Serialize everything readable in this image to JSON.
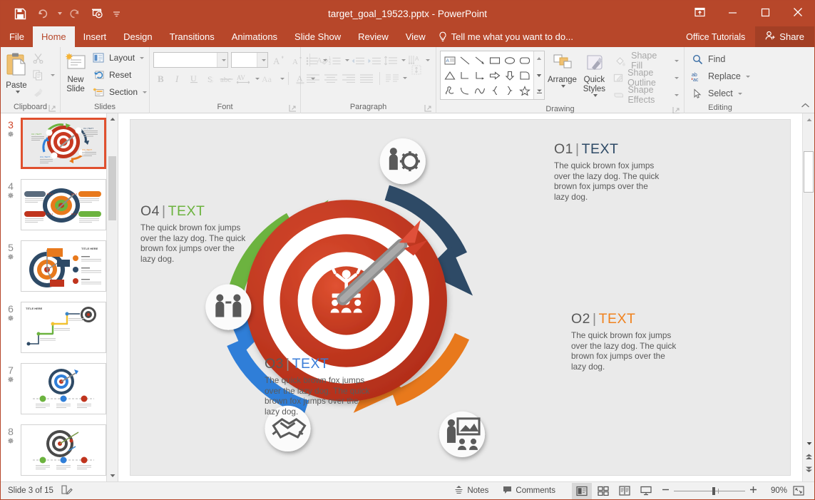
{
  "window": {
    "title": "target_goal_19523.pptx - PowerPoint",
    "accent": "#b7472a",
    "qat": [
      {
        "name": "save-icon",
        "label": "Save"
      },
      {
        "name": "undo-icon",
        "label": "Undo"
      },
      {
        "name": "redo-icon",
        "label": "Redo"
      },
      {
        "name": "start-presentation-icon",
        "label": "Start From Beginning"
      },
      {
        "name": "customize-qat-icon",
        "label": "Customize Quick Access Toolbar"
      }
    ],
    "controls": [
      {
        "name": "ribbon-display-options-icon",
        "label": "Ribbon Display Options"
      },
      {
        "name": "minimize-icon",
        "label": "Minimize"
      },
      {
        "name": "maximize-icon",
        "label": "Maximize"
      },
      {
        "name": "close-icon",
        "label": "Close"
      }
    ]
  },
  "tabs": [
    {
      "label": "File",
      "active": false
    },
    {
      "label": "Home",
      "active": true
    },
    {
      "label": "Insert",
      "active": false
    },
    {
      "label": "Design",
      "active": false
    },
    {
      "label": "Transitions",
      "active": false
    },
    {
      "label": "Animations",
      "active": false
    },
    {
      "label": "Slide Show",
      "active": false
    },
    {
      "label": "Review",
      "active": false
    },
    {
      "label": "View",
      "active": false
    }
  ],
  "tellme": {
    "placeholder": "Tell me what you want to do...",
    "icon": "lightbulb-icon"
  },
  "account": {
    "user": "Office Tutorials",
    "share_label": "Share"
  },
  "ribbon": {
    "groups": [
      {
        "name": "clipboard",
        "label": "Clipboard",
        "paste_label": "Paste",
        "items": [
          {
            "label": "Cut",
            "icon": "scissors-icon"
          },
          {
            "label": "Copy",
            "icon": "copy-icon"
          },
          {
            "label": "Format Painter",
            "icon": "format-painter-icon"
          }
        ]
      },
      {
        "name": "slides",
        "label": "Slides",
        "new_slide_label": "New Slide",
        "items": [
          {
            "label": "Layout",
            "icon": "layout-icon"
          },
          {
            "label": "Reset",
            "icon": "reset-icon"
          },
          {
            "label": "Section",
            "icon": "section-icon"
          }
        ]
      },
      {
        "name": "font",
        "label": "Font",
        "font_name": "",
        "font_size": "",
        "font_name_placeholder": "",
        "font_size_placeholder": "",
        "items": [
          {
            "label": "Increase Font Size",
            "icon": "increase-font-icon"
          },
          {
            "label": "Decrease Font Size",
            "icon": "decrease-font-icon"
          },
          {
            "label": "Clear All Formatting",
            "icon": "clear-formatting-icon"
          },
          {
            "label": "Bold",
            "icon": "bold-icon"
          },
          {
            "label": "Italic",
            "icon": "italic-icon"
          },
          {
            "label": "Underline",
            "icon": "underline-icon"
          },
          {
            "label": "Text Shadow",
            "icon": "text-shadow-icon"
          },
          {
            "label": "Strikethrough",
            "icon": "strikethrough-icon"
          },
          {
            "label": "Character Spacing",
            "icon": "character-spacing-icon"
          },
          {
            "label": "Change Case",
            "icon": "change-case-icon"
          },
          {
            "label": "Font Color",
            "icon": "font-color-icon"
          }
        ]
      },
      {
        "name": "paragraph",
        "label": "Paragraph",
        "items": [
          {
            "label": "Bullets",
            "icon": "bullets-icon"
          },
          {
            "label": "Numbering",
            "icon": "numbering-icon"
          },
          {
            "label": "Decrease List Level",
            "icon": "decrease-indent-icon"
          },
          {
            "label": "Increase List Level",
            "icon": "increase-indent-icon"
          },
          {
            "label": "Line Spacing",
            "icon": "line-spacing-icon"
          },
          {
            "label": "Text Direction",
            "icon": "text-direction-icon"
          },
          {
            "label": "Align Text",
            "icon": "align-text-icon"
          },
          {
            "label": "Convert to SmartArt",
            "icon": "smartart-icon"
          },
          {
            "label": "Align Left",
            "icon": "align-left-icon"
          },
          {
            "label": "Center",
            "icon": "align-center-icon"
          },
          {
            "label": "Align Right",
            "icon": "align-right-icon"
          },
          {
            "label": "Justify",
            "icon": "align-justify-icon"
          },
          {
            "label": "Columns",
            "icon": "columns-icon"
          }
        ]
      },
      {
        "name": "drawing",
        "label": "Drawing",
        "arrange_label": "Arrange",
        "quick_styles_label": "Quick Styles",
        "items": [
          {
            "label": "Shape Fill",
            "icon": "shape-fill-icon"
          },
          {
            "label": "Shape Outline",
            "icon": "shape-outline-icon"
          },
          {
            "label": "Shape Effects",
            "icon": "shape-effects-icon"
          }
        ],
        "shapes": [
          "text-box-shape",
          "line-shape",
          "arrow-line-shape",
          "rectangle-shape",
          "oval-shape",
          "rounded-rectangle-shape",
          "triangle-shape",
          "elbow-connector-shape",
          "elbow-arrow-connector-shape",
          "right-arrow-shape",
          "down-arrow-shape",
          "flowchart-shape",
          "scribble-shape",
          "arc-shape",
          "curve-shape",
          "left-brace-shape",
          "right-brace-shape",
          "star-shape"
        ]
      },
      {
        "name": "editing",
        "label": "Editing",
        "items": [
          {
            "label": "Find",
            "icon": "search-icon"
          },
          {
            "label": "Replace",
            "icon": "replace-icon"
          },
          {
            "label": "Select",
            "icon": "select-cursor-icon"
          }
        ]
      }
    ],
    "collapse_label": "Collapse the Ribbon"
  },
  "thumbnails": [
    {
      "number": "3",
      "selected": true,
      "starred": true
    },
    {
      "number": "4",
      "selected": false,
      "starred": true
    },
    {
      "number": "5",
      "selected": false,
      "starred": true
    },
    {
      "number": "6",
      "selected": false,
      "starred": true
    },
    {
      "number": "7",
      "selected": false,
      "starred": true
    },
    {
      "number": "8",
      "selected": false,
      "starred": true
    }
  ],
  "slide": {
    "background": "#eaeaea",
    "body_text": "The quick brown fox jumps over the lazy dog. The quick brown fox jumps over the lazy dog.",
    "blocks": [
      {
        "id": "01",
        "number": "O1",
        "sep": "|",
        "word": "TEXT",
        "color": "#2e4a66",
        "body": "The quick brown fox jumps over the lazy dog. The quick brown fox jumps over the lazy dog."
      },
      {
        "id": "02",
        "number": "O2",
        "sep": "|",
        "word": "TEXT",
        "color": "#f0821e",
        "body": "The quick brown fox jumps over the lazy dog. The quick brown fox jumps over the lazy dog."
      },
      {
        "id": "03",
        "number": "O3",
        "sep": "|",
        "word": "TEXT",
        "color": "#3b7dd8",
        "body": "The quick brown fox jumps over the lazy dog. The quick brown fox jumps over the lazy dog."
      },
      {
        "id": "04",
        "number": "O4",
        "sep": "|",
        "word": "TEXT",
        "color": "#6cb33f",
        "body": "The quick brown fox jumps over the lazy dog. The quick brown fox jumps over the lazy dog."
      }
    ],
    "bubbles": [
      {
        "name": "gear-person-icon",
        "label": "Strategy"
      },
      {
        "name": "presentation-person-icon",
        "label": "Presentation"
      },
      {
        "name": "handshake-icon",
        "label": "Partnership"
      },
      {
        "name": "meeting-people-icon",
        "label": "Meeting"
      }
    ],
    "arrows": [
      {
        "name": "green-arrow",
        "color": "#6cb33f"
      },
      {
        "name": "navy-arrow",
        "color": "#2e4a66"
      },
      {
        "name": "orange-arrow",
        "color": "#e8791c"
      },
      {
        "name": "blue-arrow",
        "color": "#2f7ed8"
      }
    ],
    "target_colors": [
      "#c0341d",
      "#ffffff",
      "#c93a22",
      "#ffffff",
      "#cf3e23"
    ]
  },
  "status": {
    "slide_counter": "Slide 3 of 15",
    "notes_label": "Notes",
    "comments_label": "Comments",
    "zoom_level": "90%",
    "accessibility_icon": "accessibility-checker-icon",
    "views": [
      {
        "name": "normal-view",
        "label": "Normal",
        "active": true
      },
      {
        "name": "slide-sorter-view",
        "label": "Slide Sorter",
        "active": false
      },
      {
        "name": "reading-view",
        "label": "Reading View",
        "active": false
      },
      {
        "name": "slide-show-view",
        "label": "Slide Show",
        "active": false
      }
    ],
    "zoom_out_label": "Zoom Out",
    "zoom_in_label": "Zoom In",
    "fit_label": "Fit slide to current window"
  }
}
